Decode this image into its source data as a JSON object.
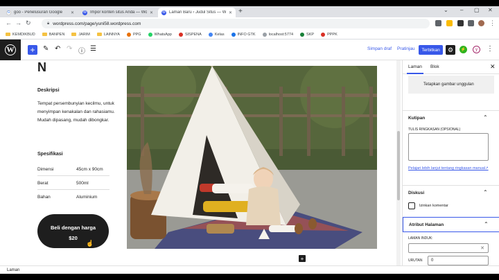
{
  "browser": {
    "tabs": [
      {
        "label": "goo - Penelusuran Google",
        "active": false
      },
      {
        "label": "Impor konten situs Anda — Wo",
        "active": false
      },
      {
        "label": "Laman Baru ‹ Judul Situs — Wo",
        "active": true
      }
    ],
    "url": "wordpress.com/page/yuni58.wordpress.com",
    "bookmarks": [
      "KEMDIKBUD",
      "BANPEN",
      "JARIM",
      "LAINNYA",
      "PPG",
      "WhatsApp",
      "SISPENA",
      "Kelas",
      "INFO GTK",
      "localhost:5774",
      "SKP",
      "PPPK"
    ]
  },
  "editor": {
    "save_draft": "Simpan draf",
    "preview": "Pratinjau",
    "publish": "Terbitkan"
  },
  "content": {
    "heading_partial": "N",
    "description_title": "Deskripsi",
    "description": "Tempat persembunyian kecilmu, untuk menyimpan kenakalan dan rahasiamu. Mudah dipasang, mudah dibongkar.",
    "spec_title": "Spesifikasi",
    "specs": [
      {
        "key": "Dimensi",
        "value": "45cm x 90cm"
      },
      {
        "key": "Berat",
        "value": "500ml"
      },
      {
        "key": "Bahan",
        "value": "Aluminium"
      }
    ],
    "buy_label": "Beli dengan harga",
    "price": "$20"
  },
  "sidebar": {
    "tab_page": "Laman",
    "tab_block": "Blok",
    "featured_image": "Tetapkan gambar unggulan",
    "excerpt_title": "Kutipan",
    "excerpt_label": "TULIS RINGKASAN (OPSIONAL)",
    "excerpt_link": "Pelajari lebih lanjut tentang ringkasan manual",
    "discussion_title": "Diskusi",
    "allow_comments": "Izinkan komentar",
    "page_attr_title": "Atribut Halaman",
    "parent_label": "LAMAN INDUK:",
    "order_label": "URUTAN",
    "order_value": "0"
  },
  "footer": {
    "breadcrumb": "Laman"
  }
}
